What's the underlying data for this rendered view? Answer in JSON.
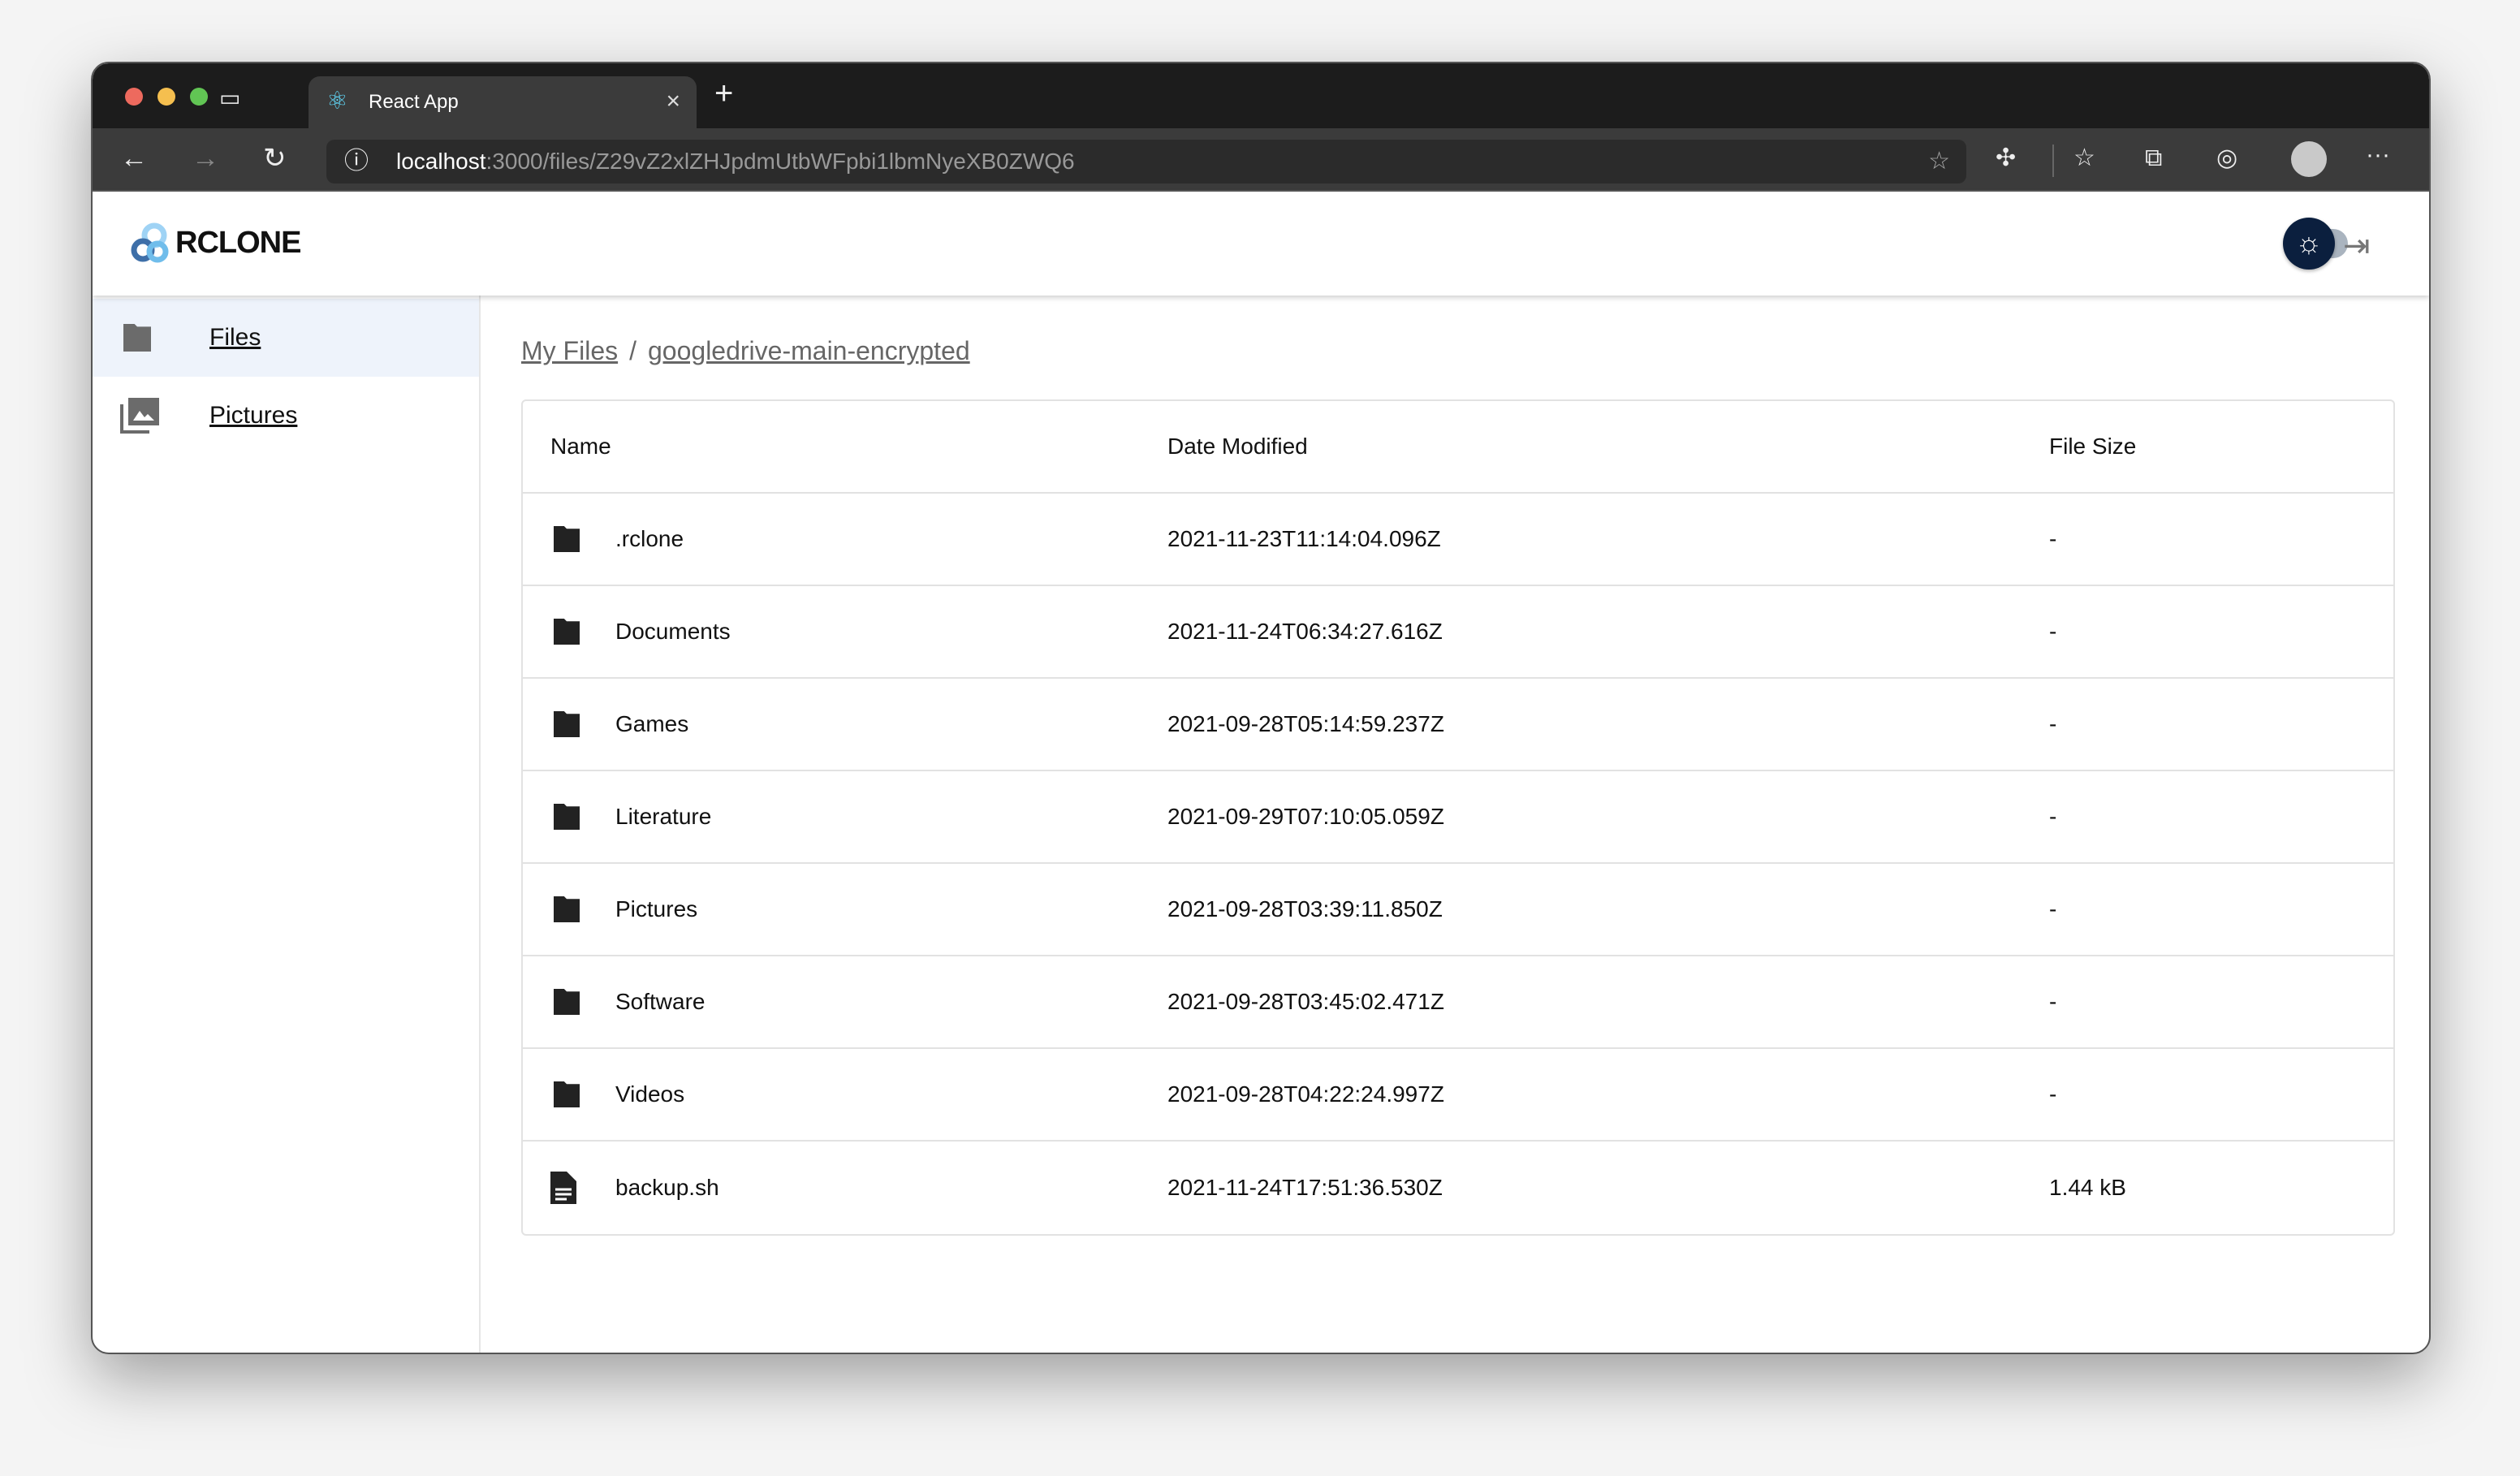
{
  "browser": {
    "tab_title": "React App",
    "url_host": "localhost",
    "url_path": ":3000/files/Z29vZ2xlZHJpdmUtbWFpbi1lbmNyeXB0ZWQ6"
  },
  "app": {
    "logo_text": "RCLONE",
    "theme": "light"
  },
  "sidebar": {
    "items": [
      {
        "label": "Files",
        "icon": "folder-icon",
        "active": true
      },
      {
        "label": "Pictures",
        "icon": "photo-library-icon",
        "active": false
      }
    ]
  },
  "breadcrumb": [
    {
      "label": "My Files"
    },
    {
      "label": "googledrive-main-encrypted"
    }
  ],
  "table": {
    "headers": [
      "Name",
      "Date Modified",
      "File Size"
    ],
    "rows": [
      {
        "name": ".rclone",
        "type": "folder",
        "modified": "2021-11-23T11:14:04.096Z",
        "size": "-"
      },
      {
        "name": "Documents",
        "type": "folder",
        "modified": "2021-11-24T06:34:27.616Z",
        "size": "-"
      },
      {
        "name": "Games",
        "type": "folder",
        "modified": "2021-09-28T05:14:59.237Z",
        "size": "-"
      },
      {
        "name": "Literature",
        "type": "folder",
        "modified": "2021-09-29T07:10:05.059Z",
        "size": "-"
      },
      {
        "name": "Pictures",
        "type": "folder",
        "modified": "2021-09-28T03:39:11.850Z",
        "size": "-"
      },
      {
        "name": "Software",
        "type": "folder",
        "modified": "2021-09-28T03:45:02.471Z",
        "size": "-"
      },
      {
        "name": "Videos",
        "type": "folder",
        "modified": "2021-09-28T04:22:24.997Z",
        "size": "-"
      },
      {
        "name": "backup.sh",
        "type": "file",
        "modified": "2021-11-24T17:51:36.530Z",
        "size": "1.44 kB"
      }
    ]
  },
  "colors": {
    "accent": "#0b1f3e",
    "active_bg": "#eef3fb"
  }
}
